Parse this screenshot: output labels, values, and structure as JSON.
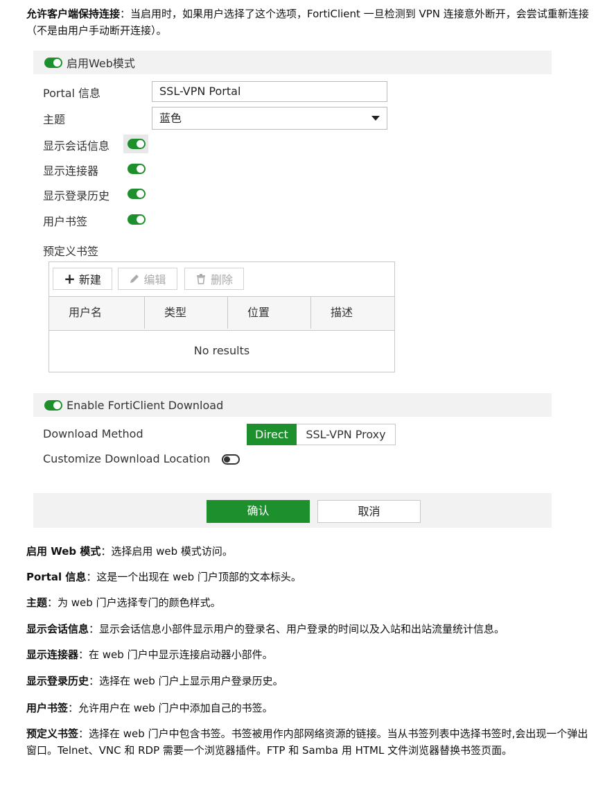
{
  "intro": {
    "bold": "允许客户端保持连接",
    "text": "：当启用时，如果用户选择了这个选项，FortiClient 一旦检测到 VPN 连接意外断开，会尝试重新连接（不是由用户手动断开连接）。"
  },
  "web_mode": {
    "title": "启用Web模式",
    "enabled": true,
    "portal_label": "Portal 信息",
    "portal_value": "SSL-VPN Portal",
    "theme_label": "主题",
    "theme_value": "蓝色",
    "toggles": [
      {
        "label": "显示会话信息",
        "on": true
      },
      {
        "label": "显示连接器",
        "on": true
      },
      {
        "label": "显示登录历史",
        "on": true
      },
      {
        "label": "用户书签",
        "on": true
      }
    ],
    "bookmarks_label": "预定义书签",
    "toolbar": {
      "new": "新建",
      "edit": "编辑",
      "delete": "删除"
    },
    "columns": [
      "用户名",
      "类型",
      "位置",
      "描述"
    ],
    "empty_text": "No results"
  },
  "forticlient": {
    "title": "Enable FortiClient Download",
    "enabled": true,
    "method_label": "Download Method",
    "method_options": [
      "Direct",
      "SSL-VPN Proxy"
    ],
    "method_selected": "Direct",
    "customize_label": "Customize Download Location",
    "customize_on": false
  },
  "actions": {
    "ok": "确认",
    "cancel": "取消"
  },
  "descriptions": [
    {
      "bold": "启用 Web 模式",
      "text": "：选择启用 web 模式访问。"
    },
    {
      "bold": "Portal 信息",
      "text": "：这是一个出现在 web 门户顶部的文本标头。"
    },
    {
      "bold": "主题",
      "text": "：为 web 门户选择专门的颜色样式。"
    },
    {
      "bold": "显示会话信息",
      "text": "：显示会话信息小部件显示用户的登录名、用户登录的时间以及入站和出站流量统计信息。"
    },
    {
      "bold": "显示连接器",
      "text": "：在 web 门户中显示连接启动器小部件。"
    },
    {
      "bold": "显示登录历史",
      "text": "：选择在 web 门户上显示用户登录历史。"
    },
    {
      "bold": "用户书签",
      "text": "：允许用户在 web 门户中添加自己的书签。"
    },
    {
      "bold": "预定义书签",
      "text": "：选择在 web 门户中包含书签。书签被用作内部网络资源的链接。当从书签列表中选择书签时,会出现一个弹出窗口。Telnet、VNC 和 RDP 需要一个浏览器插件。FTP 和 Samba 用 HTML 文件浏览器替换书签页面。"
    }
  ],
  "colors": {
    "accent": "#1d8f2c",
    "panel": "#f2f2f2"
  }
}
